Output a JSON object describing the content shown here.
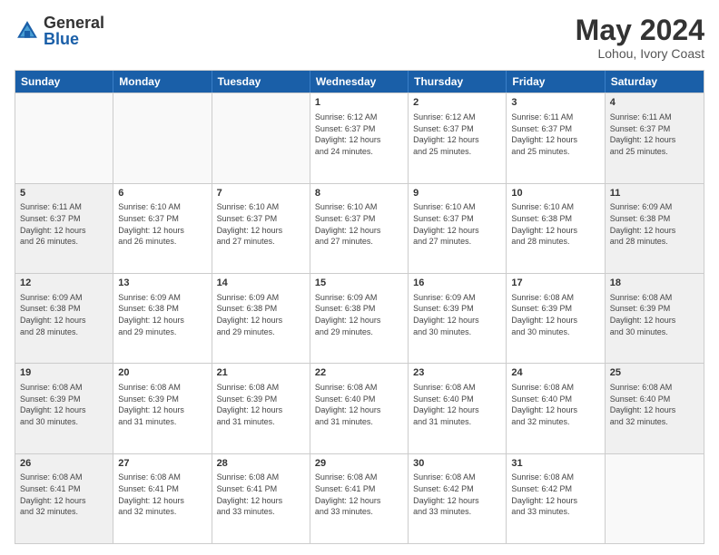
{
  "logo": {
    "general": "General",
    "blue": "Blue"
  },
  "header": {
    "month_year": "May 2024",
    "location": "Lohou, Ivory Coast"
  },
  "days_of_week": [
    "Sunday",
    "Monday",
    "Tuesday",
    "Wednesday",
    "Thursday",
    "Friday",
    "Saturday"
  ],
  "rows": [
    [
      {
        "day": "",
        "info": "",
        "empty": true
      },
      {
        "day": "",
        "info": "",
        "empty": true
      },
      {
        "day": "",
        "info": "",
        "empty": true
      },
      {
        "day": "1",
        "info": "Sunrise: 6:12 AM\nSunset: 6:37 PM\nDaylight: 12 hours\nand 24 minutes.",
        "empty": false
      },
      {
        "day": "2",
        "info": "Sunrise: 6:12 AM\nSunset: 6:37 PM\nDaylight: 12 hours\nand 25 minutes.",
        "empty": false
      },
      {
        "day": "3",
        "info": "Sunrise: 6:11 AM\nSunset: 6:37 PM\nDaylight: 12 hours\nand 25 minutes.",
        "empty": false
      },
      {
        "day": "4",
        "info": "Sunrise: 6:11 AM\nSunset: 6:37 PM\nDaylight: 12 hours\nand 25 minutes.",
        "empty": false,
        "shaded": true
      }
    ],
    [
      {
        "day": "5",
        "info": "Sunrise: 6:11 AM\nSunset: 6:37 PM\nDaylight: 12 hours\nand 26 minutes.",
        "empty": false,
        "shaded": true
      },
      {
        "day": "6",
        "info": "Sunrise: 6:10 AM\nSunset: 6:37 PM\nDaylight: 12 hours\nand 26 minutes.",
        "empty": false
      },
      {
        "day": "7",
        "info": "Sunrise: 6:10 AM\nSunset: 6:37 PM\nDaylight: 12 hours\nand 27 minutes.",
        "empty": false
      },
      {
        "day": "8",
        "info": "Sunrise: 6:10 AM\nSunset: 6:37 PM\nDaylight: 12 hours\nand 27 minutes.",
        "empty": false
      },
      {
        "day": "9",
        "info": "Sunrise: 6:10 AM\nSunset: 6:37 PM\nDaylight: 12 hours\nand 27 minutes.",
        "empty": false
      },
      {
        "day": "10",
        "info": "Sunrise: 6:10 AM\nSunset: 6:38 PM\nDaylight: 12 hours\nand 28 minutes.",
        "empty": false
      },
      {
        "day": "11",
        "info": "Sunrise: 6:09 AM\nSunset: 6:38 PM\nDaylight: 12 hours\nand 28 minutes.",
        "empty": false,
        "shaded": true
      }
    ],
    [
      {
        "day": "12",
        "info": "Sunrise: 6:09 AM\nSunset: 6:38 PM\nDaylight: 12 hours\nand 28 minutes.",
        "empty": false,
        "shaded": true
      },
      {
        "day": "13",
        "info": "Sunrise: 6:09 AM\nSunset: 6:38 PM\nDaylight: 12 hours\nand 29 minutes.",
        "empty": false
      },
      {
        "day": "14",
        "info": "Sunrise: 6:09 AM\nSunset: 6:38 PM\nDaylight: 12 hours\nand 29 minutes.",
        "empty": false
      },
      {
        "day": "15",
        "info": "Sunrise: 6:09 AM\nSunset: 6:38 PM\nDaylight: 12 hours\nand 29 minutes.",
        "empty": false
      },
      {
        "day": "16",
        "info": "Sunrise: 6:09 AM\nSunset: 6:39 PM\nDaylight: 12 hours\nand 30 minutes.",
        "empty": false
      },
      {
        "day": "17",
        "info": "Sunrise: 6:08 AM\nSunset: 6:39 PM\nDaylight: 12 hours\nand 30 minutes.",
        "empty": false
      },
      {
        "day": "18",
        "info": "Sunrise: 6:08 AM\nSunset: 6:39 PM\nDaylight: 12 hours\nand 30 minutes.",
        "empty": false,
        "shaded": true
      }
    ],
    [
      {
        "day": "19",
        "info": "Sunrise: 6:08 AM\nSunset: 6:39 PM\nDaylight: 12 hours\nand 30 minutes.",
        "empty": false,
        "shaded": true
      },
      {
        "day": "20",
        "info": "Sunrise: 6:08 AM\nSunset: 6:39 PM\nDaylight: 12 hours\nand 31 minutes.",
        "empty": false
      },
      {
        "day": "21",
        "info": "Sunrise: 6:08 AM\nSunset: 6:39 PM\nDaylight: 12 hours\nand 31 minutes.",
        "empty": false
      },
      {
        "day": "22",
        "info": "Sunrise: 6:08 AM\nSunset: 6:40 PM\nDaylight: 12 hours\nand 31 minutes.",
        "empty": false
      },
      {
        "day": "23",
        "info": "Sunrise: 6:08 AM\nSunset: 6:40 PM\nDaylight: 12 hours\nand 31 minutes.",
        "empty": false
      },
      {
        "day": "24",
        "info": "Sunrise: 6:08 AM\nSunset: 6:40 PM\nDaylight: 12 hours\nand 32 minutes.",
        "empty": false
      },
      {
        "day": "25",
        "info": "Sunrise: 6:08 AM\nSunset: 6:40 PM\nDaylight: 12 hours\nand 32 minutes.",
        "empty": false,
        "shaded": true
      }
    ],
    [
      {
        "day": "26",
        "info": "Sunrise: 6:08 AM\nSunset: 6:41 PM\nDaylight: 12 hours\nand 32 minutes.",
        "empty": false,
        "shaded": true
      },
      {
        "day": "27",
        "info": "Sunrise: 6:08 AM\nSunset: 6:41 PM\nDaylight: 12 hours\nand 32 minutes.",
        "empty": false
      },
      {
        "day": "28",
        "info": "Sunrise: 6:08 AM\nSunset: 6:41 PM\nDaylight: 12 hours\nand 33 minutes.",
        "empty": false
      },
      {
        "day": "29",
        "info": "Sunrise: 6:08 AM\nSunset: 6:41 PM\nDaylight: 12 hours\nand 33 minutes.",
        "empty": false
      },
      {
        "day": "30",
        "info": "Sunrise: 6:08 AM\nSunset: 6:42 PM\nDaylight: 12 hours\nand 33 minutes.",
        "empty": false
      },
      {
        "day": "31",
        "info": "Sunrise: 6:08 AM\nSunset: 6:42 PM\nDaylight: 12 hours\nand 33 minutes.",
        "empty": false
      },
      {
        "day": "",
        "info": "",
        "empty": true
      }
    ]
  ]
}
